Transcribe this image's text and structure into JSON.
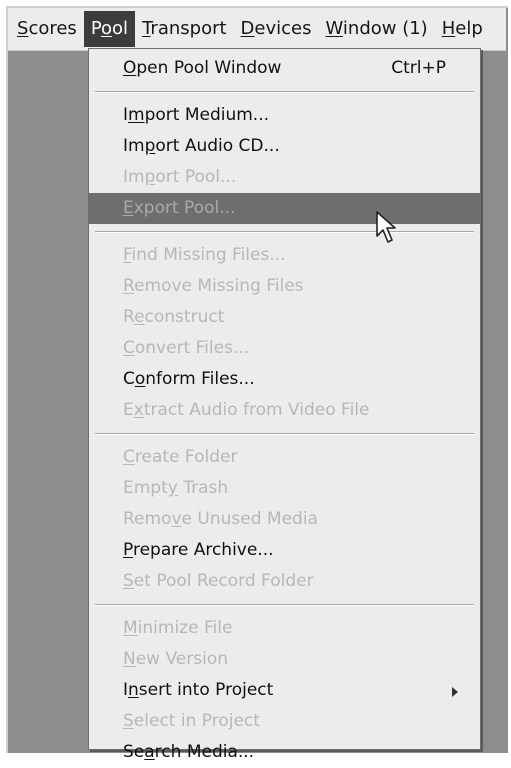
{
  "menubar": {
    "items": [
      {
        "pre": "",
        "u": "S",
        "post": "cores"
      },
      {
        "pre": "P",
        "u": "o",
        "post": "ol"
      },
      {
        "pre": "",
        "u": "T",
        "post": "ransport"
      },
      {
        "pre": "",
        "u": "D",
        "post": "evices"
      },
      {
        "pre": "",
        "u": "W",
        "post": "indow (1)"
      },
      {
        "pre": "",
        "u": "H",
        "post": "elp"
      }
    ],
    "active_index": 1
  },
  "menu": {
    "items": [
      {
        "pre": "",
        "u": "O",
        "post": "pen Pool Window",
        "shortcut": "Ctrl+P",
        "state": "enabled"
      },
      {
        "pre": "I",
        "u": "m",
        "post": "port Medium...",
        "state": "enabled"
      },
      {
        "pre": "Im",
        "u": "p",
        "post": "ort Audio CD...",
        "state": "enabled"
      },
      {
        "pre": "Im",
        "u": "p",
        "post": "ort Pool...",
        "state": "disabled"
      },
      {
        "pre": "",
        "u": "E",
        "post": "xport Pool...",
        "state": "highlighted-disabled"
      },
      {
        "pre": "",
        "u": "F",
        "post": "ind Missing Files...",
        "state": "disabled"
      },
      {
        "pre": "",
        "u": "R",
        "post": "emove Missing Files",
        "state": "disabled"
      },
      {
        "pre": "R",
        "u": "e",
        "post": "construct",
        "state": "disabled"
      },
      {
        "pre": "",
        "u": "C",
        "post": "onvert Files...",
        "state": "disabled"
      },
      {
        "pre": "C",
        "u": "o",
        "post": "nform Files...",
        "state": "enabled"
      },
      {
        "pre": "E",
        "u": "x",
        "post": "tract Audio from Video File",
        "state": "disabled"
      },
      {
        "pre": "",
        "u": "C",
        "post": "reate Folder",
        "state": "disabled"
      },
      {
        "pre": "Empt",
        "u": "y",
        "post": " Trash",
        "state": "disabled"
      },
      {
        "pre": "Remo",
        "u": "v",
        "post": "e Unused Media",
        "state": "disabled"
      },
      {
        "pre": "",
        "u": "P",
        "post": "repare Archive...",
        "state": "enabled"
      },
      {
        "pre": "",
        "u": "S",
        "post": "et Pool Record Folder",
        "state": "disabled"
      },
      {
        "pre": "",
        "u": "M",
        "post": "inimize File",
        "state": "disabled"
      },
      {
        "pre": "",
        "u": "N",
        "post": "ew Version",
        "state": "disabled"
      },
      {
        "pre": "I",
        "u": "n",
        "post": "sert into Project",
        "state": "enabled",
        "submenu": true
      },
      {
        "pre": "",
        "u": "S",
        "post": "elect in Project",
        "state": "disabled"
      },
      {
        "pre": "Se",
        "u": "a",
        "post": "rch Media...",
        "state": "enabled"
      }
    ],
    "separators_after": [
      0,
      4,
      10,
      15
    ]
  },
  "colors": {
    "menubar_bg": "#ececec",
    "active_title_bg": "#3c3c3c",
    "highlight_bg": "#6e6e6e",
    "disabled_text": "#b7b7b7",
    "workspace_bg": "#8d8d8d"
  },
  "cursor": {
    "icon": "arrow-pointer-icon"
  }
}
